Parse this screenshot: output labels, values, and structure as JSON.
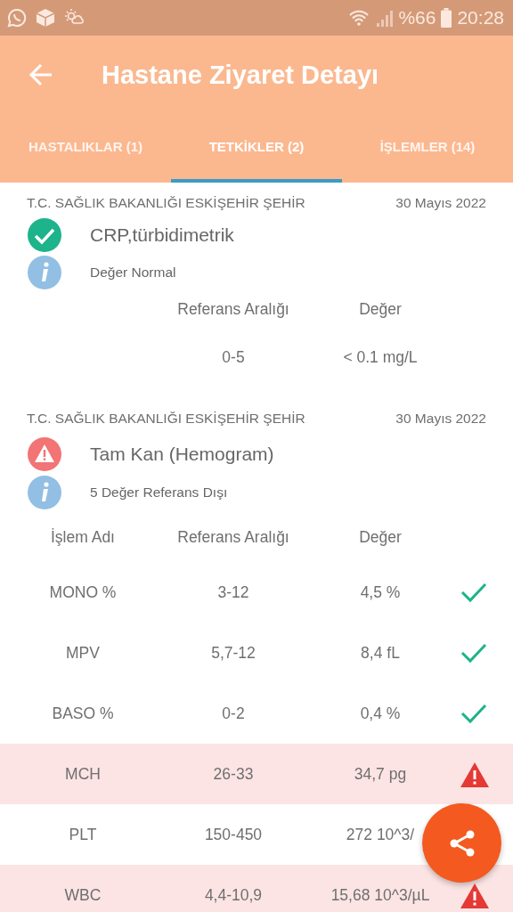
{
  "status_bar": {
    "battery_text": "%66",
    "time": "20:28"
  },
  "app_bar": {
    "title": "Hastane Ziyaret Detayı"
  },
  "tabs": [
    {
      "label": "HASTALIKLAR (1)",
      "selected": false
    },
    {
      "label": "TETKİKLER (2)",
      "selected": true
    },
    {
      "label": "İŞLEMLER (14)",
      "selected": false
    }
  ],
  "tests": [
    {
      "hospital": "T.C. SAĞLIK BAKANLIĞI ESKİŞEHİR ŞEHİR",
      "date": "30 Mayıs 2022",
      "name": "CRP,türbidimetrik",
      "kind": "normal",
      "info": "Değer Normal",
      "columns": [
        {
          "kind": "reference",
          "label": "Referans Aralığı"
        },
        {
          "kind": "value",
          "label": "Değer"
        }
      ],
      "rows": [
        {
          "reference": "0-5",
          "value": "< 0.1 mg/L"
        }
      ]
    },
    {
      "hospital": "T.C. SAĞLIK BAKANLIĞI ESKİŞEHİR ŞEHİR",
      "date": "30 Mayıs 2022",
      "name": "Tam Kan (Hemogram)",
      "kind": "abnormal",
      "info": "5 Değer Referans Dışı",
      "columns": [
        {
          "kind": "name",
          "label": "İşlem Adı"
        },
        {
          "kind": "reference",
          "label": "Referans Aralığı"
        },
        {
          "kind": "value",
          "label": "Değer"
        }
      ],
      "rows": [
        {
          "name": "MONO %",
          "reference": "3-12",
          "value": "4,5 %",
          "kind": "normal"
        },
        {
          "name": "MPV",
          "reference": "5,7-12",
          "value": "8,4 fL",
          "kind": "normal"
        },
        {
          "name": "BASO %",
          "reference": "0-2",
          "value": "0,4 %",
          "kind": "normal"
        },
        {
          "name": "MCH",
          "reference": "26-33",
          "value": "34,7 pg",
          "kind": "abnormal"
        },
        {
          "name": "PLT",
          "reference": "150-450",
          "value": "272 10^3/"
        },
        {
          "name": "WBC",
          "reference": "4,4-10,9",
          "value": "15,68 10^3/µL",
          "kind": "abnormal"
        }
      ]
    }
  ]
}
